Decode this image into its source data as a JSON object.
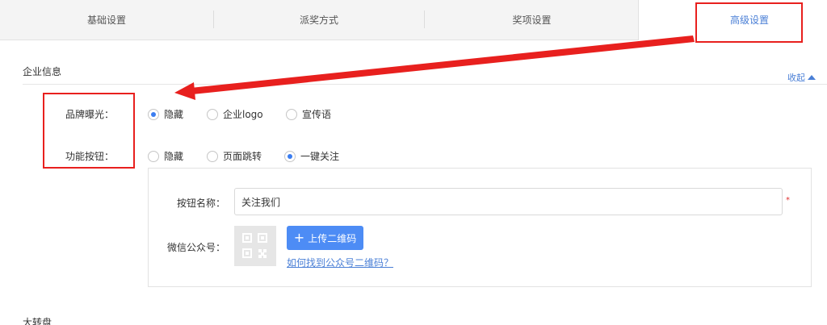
{
  "tabs": [
    {
      "label": "基础设置"
    },
    {
      "label": "派奖方式"
    },
    {
      "label": "奖项设置"
    },
    {
      "label": "高级设置"
    }
  ],
  "section": {
    "title": "企业信息",
    "collapse_label": "收起"
  },
  "brand_exposure": {
    "label": "品牌曝光：",
    "options": [
      "隐藏",
      "企业logo",
      "宣传语"
    ],
    "selected": "隐藏"
  },
  "function_button": {
    "label": "功能按钮：",
    "options": [
      "隐藏",
      "页面跳转",
      "一键关注"
    ],
    "selected": "一键关注"
  },
  "button_name": {
    "label": "按钮名称：",
    "value": "关注我们",
    "required_mark": "*"
  },
  "wechat_account": {
    "label": "微信公众号：",
    "upload_label": "上传二维码",
    "upload_icon": "plus-icon",
    "help_link": "如何找到公众号二维码？"
  },
  "next_section_title": "大转盘",
  "colors": {
    "accent": "#4d8cf5",
    "annotation": "#e8201e",
    "link": "#4a7fd6"
  }
}
